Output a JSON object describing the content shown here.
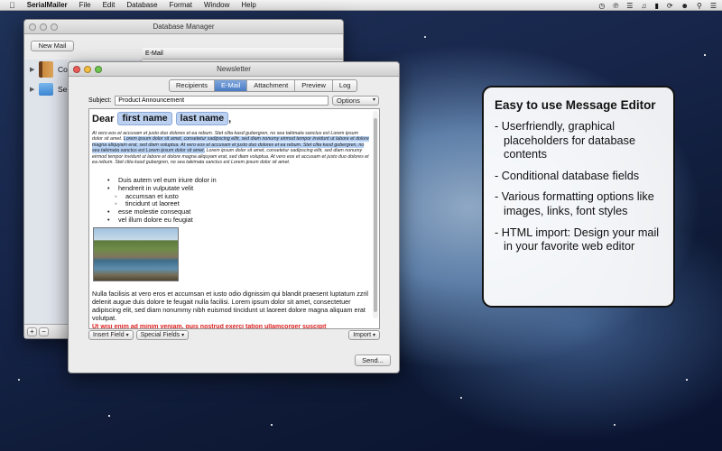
{
  "menubar": {
    "apple": "",
    "app_name": "SerialMailer",
    "items": [
      "File",
      "Edit",
      "Database",
      "Format",
      "Window",
      "Help"
    ]
  },
  "db_manager": {
    "title": "Database Manager",
    "new_mail_label": "New Mail",
    "column_header": "E-Mail",
    "sidebar": [
      {
        "label": "Contacts",
        "icon": "address-book-icon"
      },
      {
        "label": "Se",
        "icon": "folder-icon"
      }
    ],
    "add_label": "+",
    "remove_label": "−"
  },
  "newsletter": {
    "title": "Newsletter",
    "tabs": [
      "Recipients",
      "E-Mail",
      "Attachment",
      "Preview",
      "Log"
    ],
    "active_tab": "E-Mail",
    "subject_label": "Subject:",
    "subject_value": "Product Announcement",
    "options_label": "Options",
    "greeting": "Dear",
    "placeholder_first": "first name",
    "placeholder_last": "last name",
    "greeting_suffix": ",",
    "lorem_1": "At vero eos et accusam et justo duo dolores et ea rebum. Stet clita kasd gubergren, no sea takimata sanctus est Lorem ipsum dolor sit amet.",
    "lorem_hl": "Lorem ipsum dolor sit amet, consetetur sadipscing elitr, sed diam nonumy eirmod tempor invidunt ut labore et dolore magna aliquyam erat, sed diam voluptua. At vero eos et accusam et justo duo dolores et ea rebum. Stet clita kasd gubergren, no sea takimata sanctus est Lorem ipsum dolor sit amet.",
    "lorem_2": "Lorem ipsum dolor sit amet, consetetur sadipscing elitr, sed diam nonumy eirmod tempor invidunt ut labore et dolore magna aliquyam erat, sed diam voluptua. At vero eos et accusam et justo duo dolores et ea rebum. Stet clita kasd gubergren, no sea takimata sanctus est Lorem ipsum dolor sit amet.",
    "bullets": [
      {
        "text": "Duis autem vel eum iriure dolor in",
        "sub": false
      },
      {
        "text": "hendrerit in vulputate velit",
        "sub": false
      },
      {
        "text": "accumsan et iusto",
        "sub": true
      },
      {
        "text": "tincidunt ut laoreet",
        "sub": true
      },
      {
        "text": "esse molestie consequat",
        "sub": false
      },
      {
        "text": "vel illum dolore eu feugiat",
        "sub": false
      }
    ],
    "paragraph": "Nulla facilisis at vero eros et accumsan et iusto odio dignissim qui blandit praesent luptatum zzril delenit augue duis dolore te feugait nulla facilisi. Lorem ipsum dolor sit amet, consectetuer adipiscing elit, sed diam nonummy nibh euismod tincidunt ut laoreet dolore magna aliquam erat volutpat.",
    "red_text": "Ut wisi enim ad minim veniam, quis nostrud exerci tation ullamcorper suscipit",
    "insert_field_label": "Insert Field",
    "special_fields_label": "Special Fields",
    "import_label": "Import",
    "send_label": "Send..."
  },
  "promo": {
    "title": "Easy to use Message Editor",
    "items": [
      "- Userfriendly, graphical placeholders for database contents",
      "- Conditional database fields",
      "- Various formatting options like images, links, font styles",
      "- HTML import: Design your mail in your favorite web editor"
    ]
  },
  "colors": {
    "accent_tab": "#4a7bc6",
    "placeholder_bg": "#bcd0f0",
    "highlight": "#b7d2f5",
    "red_text": "#dd2222"
  }
}
